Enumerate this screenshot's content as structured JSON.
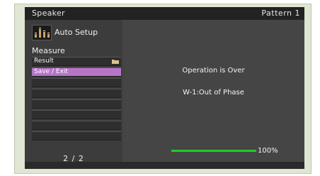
{
  "header": {
    "title": "Speaker",
    "pattern": "Pattern 1"
  },
  "sidebar": {
    "auto_setup_icon": "speaker-levels-icon",
    "auto_setup_label": "Auto Setup",
    "section_label": "Measure",
    "items": [
      {
        "label": "Result",
        "icon": "folder-icon",
        "selected": false
      },
      {
        "label": "Save / Exit",
        "selected": true
      },
      {
        "label": ""
      },
      {
        "label": ""
      },
      {
        "label": ""
      },
      {
        "label": ""
      },
      {
        "label": ""
      },
      {
        "label": ""
      }
    ],
    "page_indicator": "2 / 2"
  },
  "main": {
    "status_line_1": "Operation is Over",
    "status_line_2": "W-1:Out of Phase"
  },
  "progress": {
    "percent": 100,
    "label": "100%",
    "color": "#22cc22"
  },
  "colors": {
    "selected_item": "#b774c9",
    "title_bar": "#222222",
    "frame": "#dfe6d3"
  }
}
